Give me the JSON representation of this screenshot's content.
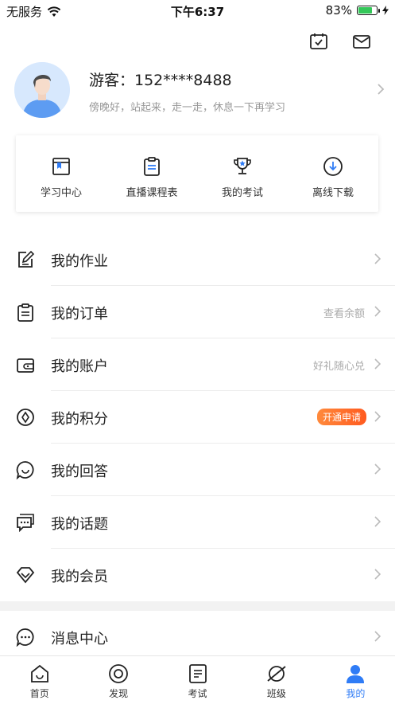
{
  "status_bar": {
    "carrier": "无服务",
    "time": "下午6:37",
    "battery": "83%",
    "battery_level": 0.83
  },
  "profile": {
    "name": "游客：152****8488",
    "subtitle": "傍晚好，站起来，走一走，休息一下再学习"
  },
  "quick_actions": [
    {
      "label": "学习中心",
      "icon": "bookmark-book-icon"
    },
    {
      "label": "直播课程表",
      "icon": "clipboard-icon"
    },
    {
      "label": "我的考试",
      "icon": "trophy-icon"
    },
    {
      "label": "离线下载",
      "icon": "download-icon"
    }
  ],
  "menu": [
    {
      "label": "我的作业",
      "right": "",
      "icon": "homework-icon"
    },
    {
      "label": "我的订单",
      "right": "查看余额",
      "icon": "order-icon"
    },
    {
      "label": "我的账户",
      "right": "好礼随心兑",
      "icon": "wallet-icon"
    },
    {
      "label": "我的积分",
      "badge": "开通申请",
      "icon": "points-icon"
    },
    {
      "label": "我的回答",
      "right": "",
      "icon": "chat-bubble-icon"
    },
    {
      "label": "我的话题",
      "right": "",
      "icon": "topic-icon"
    },
    {
      "label": "我的会员",
      "right": "",
      "icon": "diamond-icon"
    }
  ],
  "message_center": {
    "label": "消息中心",
    "icon": "message-dots-icon"
  },
  "tabs": [
    {
      "label": "首页",
      "icon": "home-icon"
    },
    {
      "label": "发现",
      "icon": "discover-icon"
    },
    {
      "label": "考试",
      "icon": "exam-icon"
    },
    {
      "label": "班级",
      "icon": "class-icon"
    },
    {
      "label": "我的",
      "icon": "profile-icon",
      "active": true
    }
  ],
  "colors": {
    "accent": "#2f7cf6",
    "badge": "#ff6a2a"
  }
}
